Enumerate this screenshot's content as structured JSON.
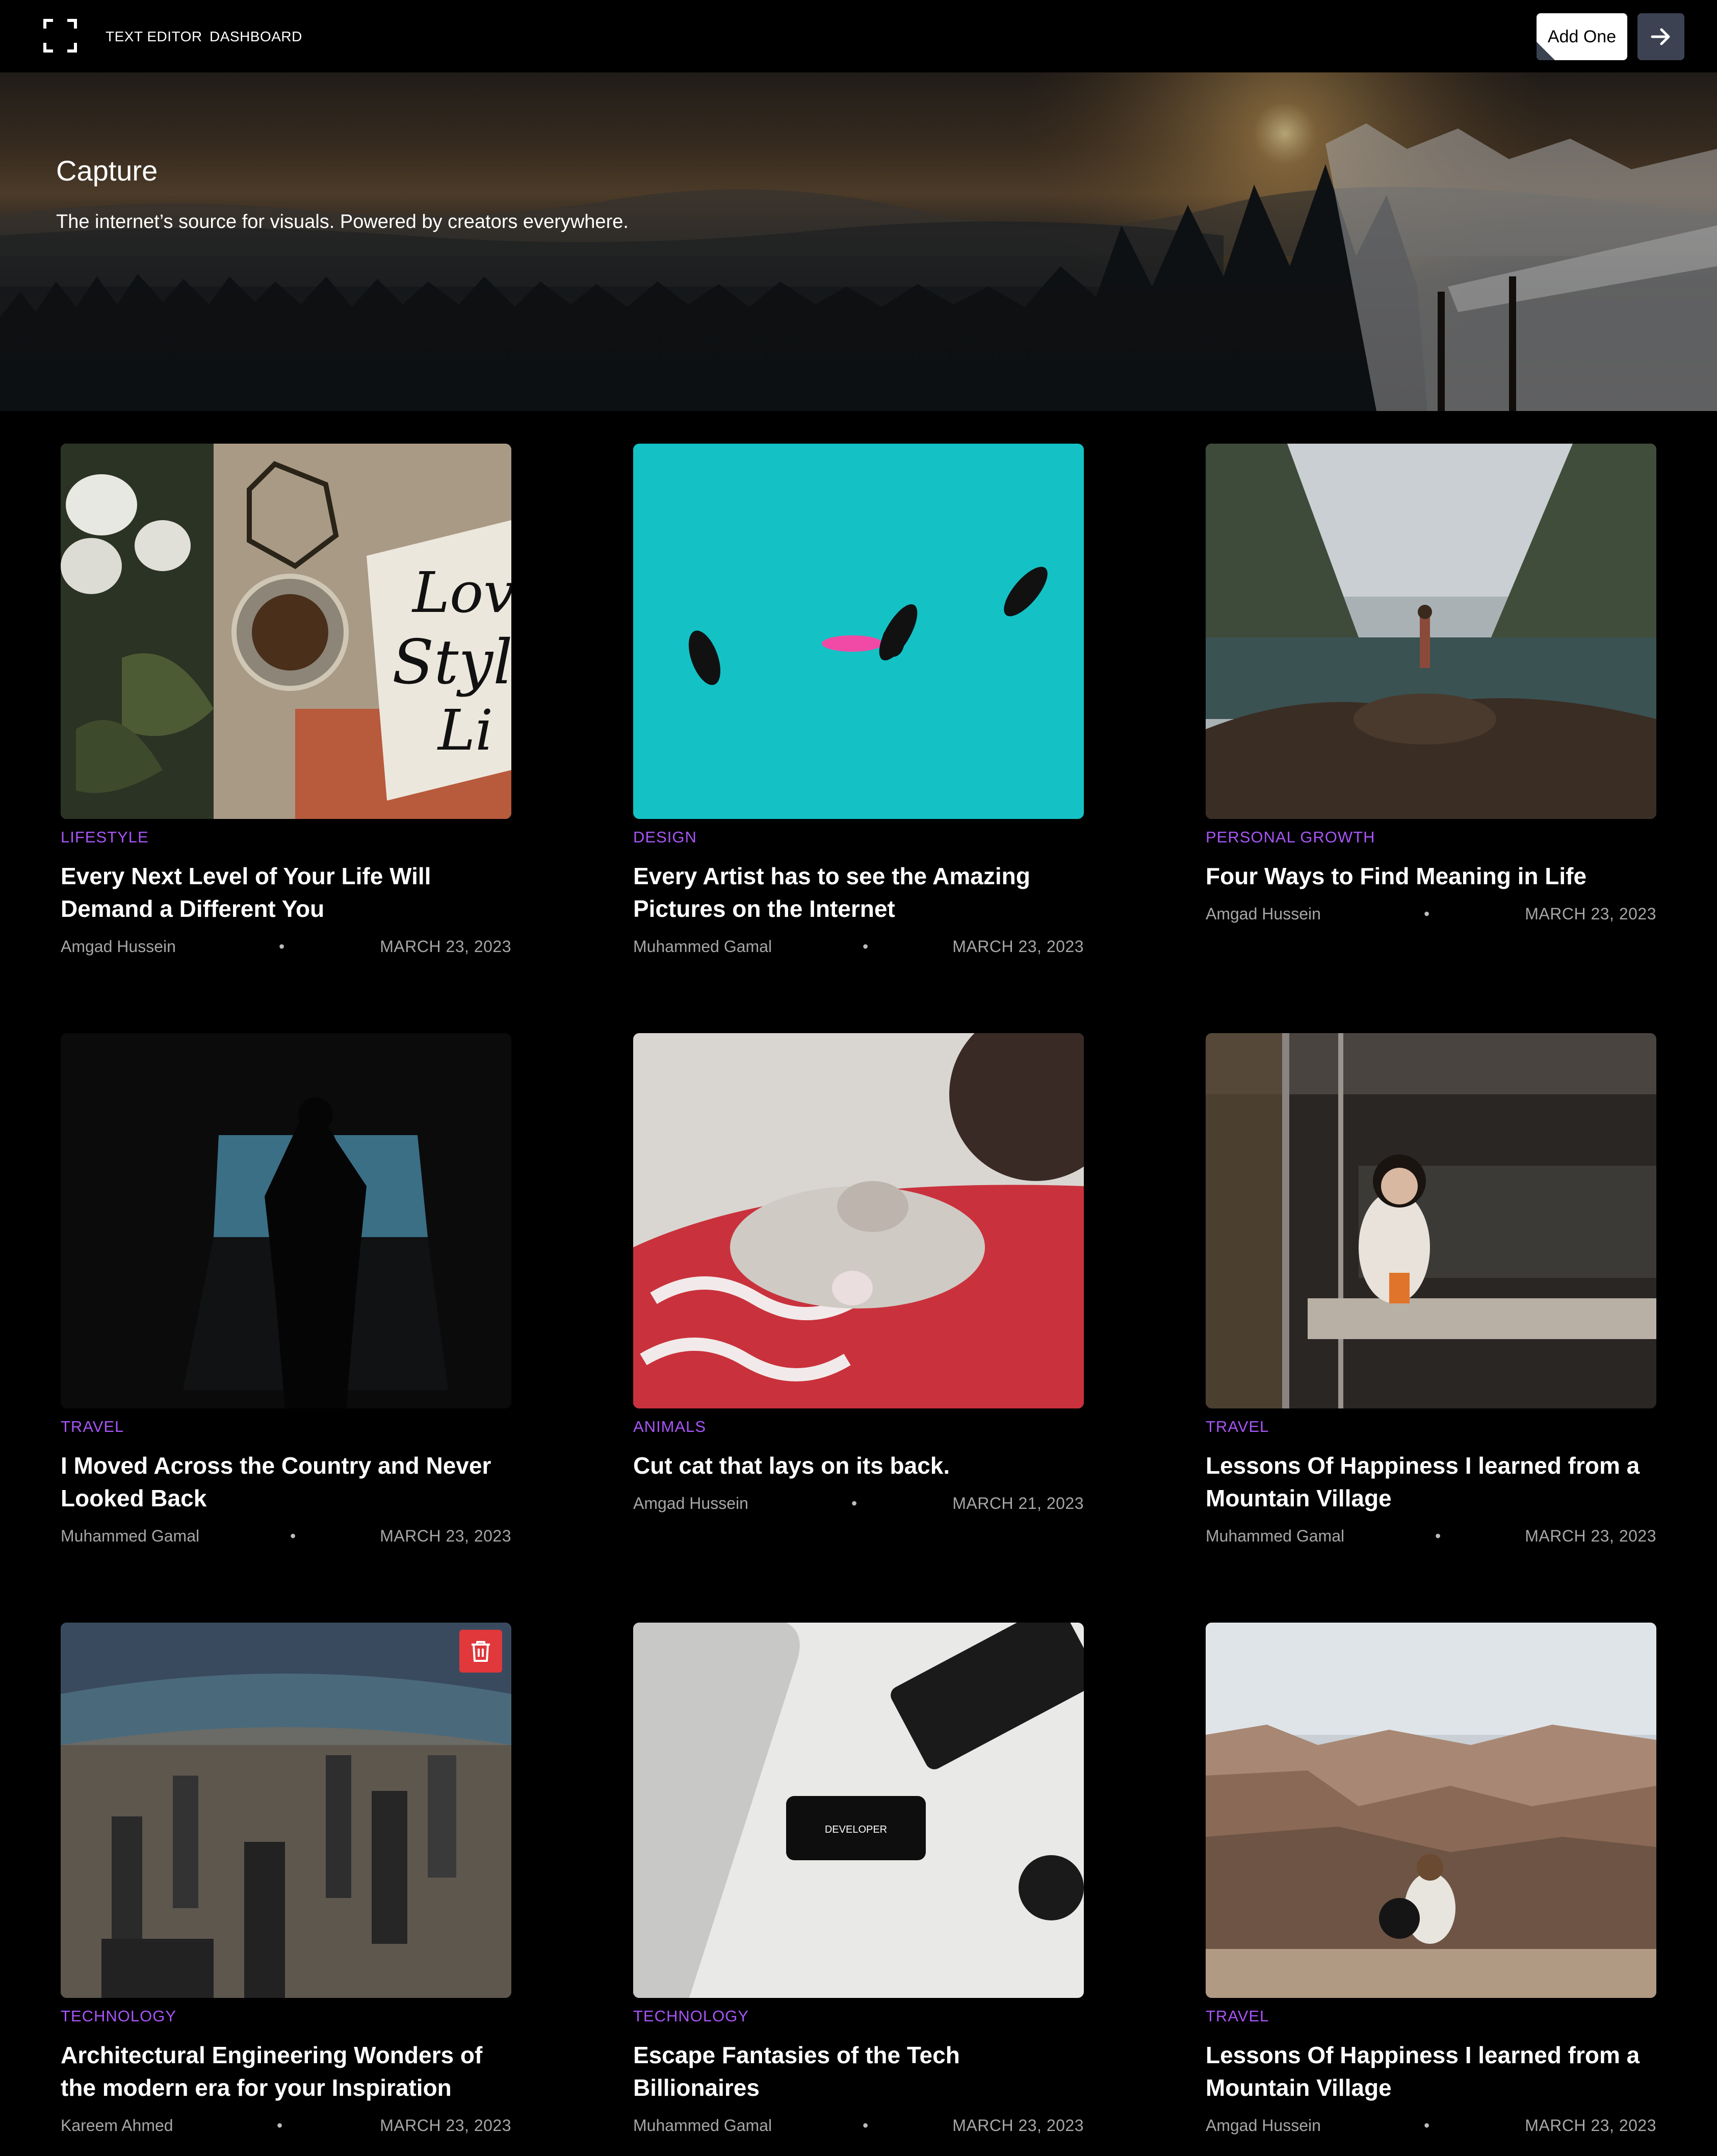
{
  "nav": {
    "logo_icon": "focus-frame-icon",
    "links": [
      "TEXT EDITOR",
      "DASHBOARD"
    ],
    "add_button_label": "Add One",
    "arrow_button_icon": "arrow-right-icon"
  },
  "hero": {
    "title": "Capture",
    "subtitle": "The internet’s source for visuals. Powered by creators everywhere."
  },
  "colors": {
    "accent": "#a855f7",
    "delete": "#e0383b",
    "arrow_button": "#3c4252"
  },
  "cards": [
    {
      "category": "LIFESTYLE",
      "title": "Every Next Level of Your Life Will Demand a Different You",
      "author": "Amgad Hussein",
      "date": "MARCH 23, 2023",
      "image_alt": "roses, coffee and book"
    },
    {
      "category": "DESIGN",
      "title": "Every Artist has to see the Amazing Pictures on the Internet",
      "author": "Muhammed Gamal",
      "date": "MARCH 23, 2023",
      "image_alt": "swimmers in turquoise water"
    },
    {
      "category": "PERSONAL GROWTH",
      "title": "Four Ways to Find Meaning in Life",
      "author": "Amgad Hussein",
      "date": "MARCH 23, 2023",
      "image_alt": "woman on rocks at mountain lake"
    },
    {
      "category": "TRAVEL",
      "title": "I Moved Across the Country and Never Looked Back",
      "author": "Muhammed Gamal",
      "date": "MARCH 23, 2023",
      "image_alt": "silhouette in dark doorway"
    },
    {
      "category": "ANIMALS",
      "title": "Cut cat that lays on its back.",
      "author": "Amgad Hussein",
      "date": "MARCH 21, 2023",
      "image_alt": "kitten on red pillow"
    },
    {
      "category": "TRAVEL",
      "title": "Lessons Of Happiness I learned from a Mountain Village",
      "author": "Muhammed Gamal",
      "date": "MARCH 23, 2023",
      "image_alt": "woman sitting in cafe"
    },
    {
      "category": "TECHNOLOGY",
      "title": "Architectural Engineering Wonders of the modern era for your Inspiration",
      "author": "Kareem Ahmed",
      "date": "MARCH 23, 2023",
      "image_alt": "city skyline from above",
      "delete_icon": "trash-icon"
    },
    {
      "category": "TECHNOLOGY",
      "title": "Escape Fantasies of the Tech Billionaires",
      "author": "Muhammed Gamal",
      "date": "MARCH 23, 2023",
      "image_alt": "laptop, keyboard and phone on white sheet",
      "phone_text": "DEVELOPER"
    },
    {
      "category": "TRAVEL",
      "title": "Lessons Of Happiness I learned from a Mountain Village",
      "author": "Amgad Hussein",
      "date": "MARCH 23, 2023",
      "image_alt": "person and dog at canyon"
    }
  ]
}
